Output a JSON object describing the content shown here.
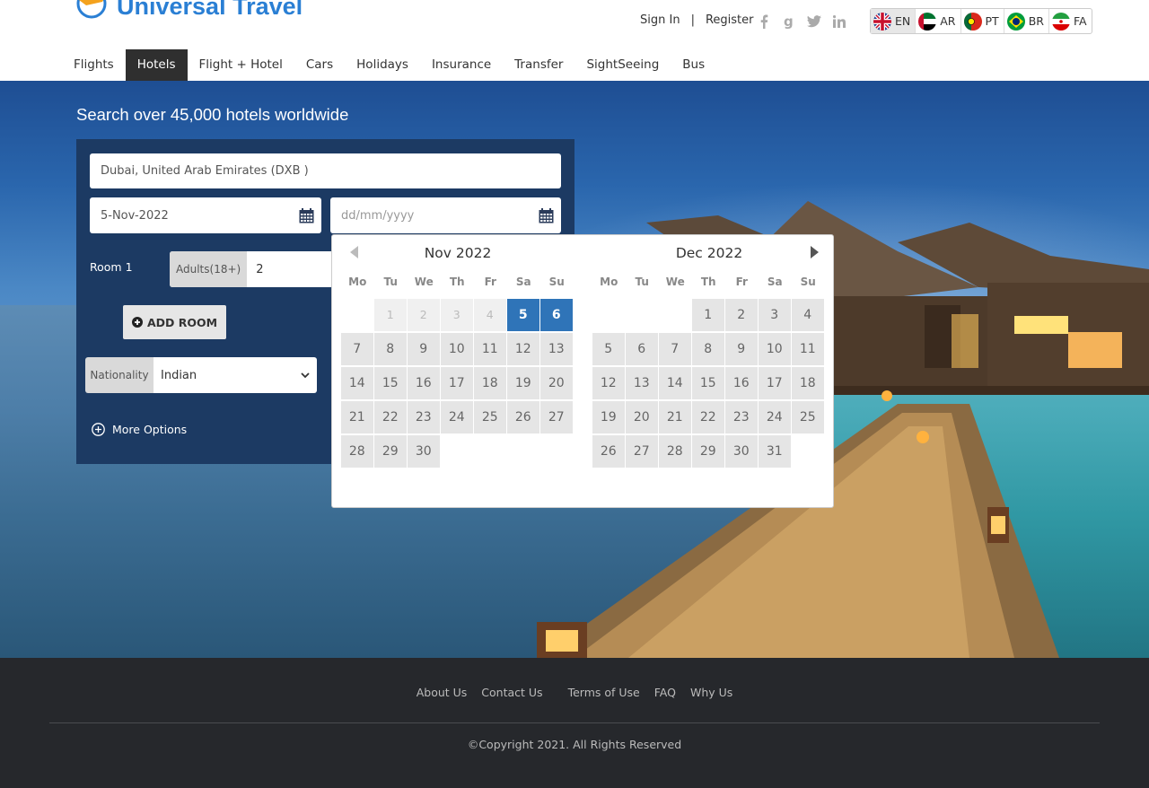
{
  "brand": {
    "name": "Universal Travel"
  },
  "header": {
    "sign_in": "Sign In",
    "separator": "|",
    "register": "Register",
    "socials": [
      "facebook-icon",
      "google-icon",
      "twitter-icon",
      "linkedin-icon"
    ],
    "languages": [
      {
        "code": "EN",
        "flag": "uk-flag-icon"
      },
      {
        "code": "AR",
        "flag": "uae-flag-icon"
      },
      {
        "code": "PT",
        "flag": "portugal-flag-icon"
      },
      {
        "code": "BR",
        "flag": "brazil-flag-icon"
      },
      {
        "code": "FA",
        "flag": "iran-flag-icon"
      }
    ]
  },
  "nav": {
    "items": [
      "Flights",
      "Hotels",
      "Flight + Hotel",
      "Cars",
      "Holidays",
      "Insurance",
      "Transfer",
      "SightSeeing",
      "Bus"
    ],
    "active": "Hotels"
  },
  "hero": {
    "title": "Search over 45,000 hotels worldwide"
  },
  "search": {
    "destination": "Dubai, United Arab Emirates (DXB )",
    "check_in": "5-Nov-2022",
    "check_out_placeholder": "dd/mm/yyyy",
    "room_label": "Room 1",
    "adults_label": "Adults(18+)",
    "adults_value": "2",
    "add_room": "ADD ROOM",
    "nationality_label": "Nationality",
    "nationality_value": "Indian",
    "more_options": "More Options"
  },
  "datepicker": {
    "weekdays": [
      "Mo",
      "Tu",
      "We",
      "Th",
      "Fr",
      "Sa",
      "Su"
    ],
    "months": [
      {
        "title": "Nov 2022",
        "leading_blanks": 1,
        "days": 30,
        "disabled_days": [
          1,
          2,
          3,
          4
        ],
        "selected_days": [
          5,
          6
        ]
      },
      {
        "title": "Dec 2022",
        "leading_blanks": 3,
        "days": 31,
        "disabled_days": [],
        "selected_days": []
      }
    ]
  },
  "footer": {
    "links": [
      "About Us",
      "Contact Us",
      "Terms of Use",
      "FAQ",
      "Why Us"
    ],
    "copyright": "©Copyright 2021. All Rights Reserved"
  }
}
